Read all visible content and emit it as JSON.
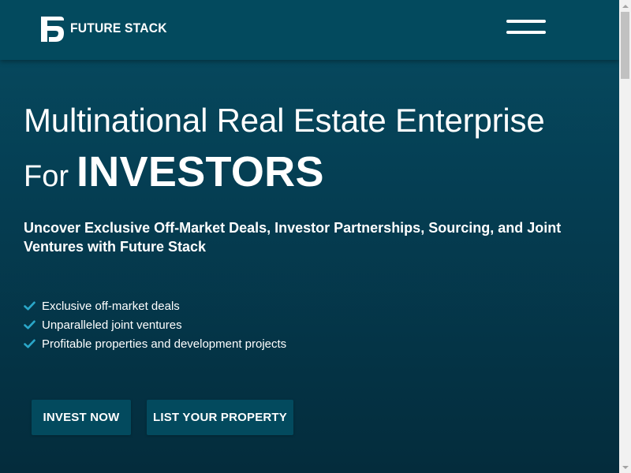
{
  "header": {
    "brand_name": "FUTURE STACK",
    "logo_icon": "fs-monogram-icon",
    "menu_icon": "hamburger-menu-icon"
  },
  "hero": {
    "title_line1": "Multinational Real Estate Enterprise",
    "title_for": "For",
    "title_investors": "INVESTORS",
    "subtitle": "Uncover Exclusive Off-Market Deals, Investor Partnerships, Sourcing, and Joint Ventures with Future Stack"
  },
  "features": [
    {
      "icon": "check-icon",
      "label": "Exclusive off-market deals"
    },
    {
      "icon": "check-icon",
      "label": "Unparalleled joint ventures"
    },
    {
      "icon": "check-icon",
      "label": "Profitable properties and development projects"
    }
  ],
  "buttons": {
    "invest_label": "INVEST NOW",
    "list_label": "LIST YOUR PROPERTY"
  },
  "colors": {
    "header_bg": "#034a5e",
    "hero_bg_top": "#064c61",
    "hero_bg_bottom": "#042c3c",
    "check_accent": "#2aa7c9",
    "button_bg": "#034a5e",
    "text": "#ffffff"
  }
}
